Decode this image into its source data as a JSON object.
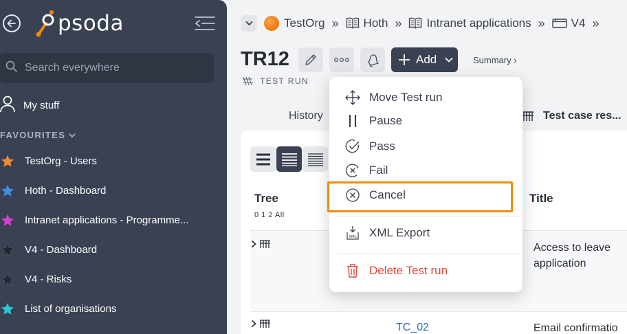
{
  "sidebar": {
    "logo_text": "psoda",
    "search_placeholder": "Search everywhere",
    "my_stuff_label": "My stuff",
    "favourites_header": "FAVOURITES",
    "favourites": [
      {
        "label": "TestOrg - Users",
        "star_color": "#f08a3a"
      },
      {
        "label": "Hoth - Dashboard",
        "star_color": "#3a8fe0"
      },
      {
        "label": "Intranet applications - Programme...",
        "star_color": "#d63fd0"
      },
      {
        "label": "V4 - Dashboard",
        "star_color": "#22262e"
      },
      {
        "label": "V4 - Risks",
        "star_color": "#22262e"
      },
      {
        "label": "List of organisations",
        "star_color": "#2ec3d6"
      }
    ]
  },
  "breadcrumb": {
    "items": [
      "TestOrg",
      "Hoth",
      "Intranet applications",
      "V4"
    ],
    "separator": "»"
  },
  "header": {
    "title": "TR12",
    "subtitle": "TEST RUN",
    "add_label": "Add",
    "summary_link": "Summary ›"
  },
  "tabs": {
    "history": "History",
    "test_case_results": "Test case res..."
  },
  "table": {
    "tree_header": "Tree",
    "tree_levels": "0 1 2 All",
    "title_header": "Title",
    "rows": [
      {
        "id": "",
        "title": "Access to leave application"
      },
      {
        "id": "TC_02",
        "title": "Email confirmatio"
      }
    ]
  },
  "menu": {
    "items": [
      {
        "label": "Move Test run",
        "icon": "move-icon"
      },
      {
        "label": "Pause",
        "icon": "pause-icon"
      },
      {
        "label": "Pass",
        "icon": "pass-icon"
      },
      {
        "label": "Fail",
        "icon": "fail-icon"
      },
      {
        "label": "Cancel",
        "icon": "cancel-icon"
      },
      {
        "label": "XML Export",
        "icon": "xml-export-icon"
      },
      {
        "label": "Delete Test run",
        "icon": "trash-icon"
      }
    ],
    "highlighted_item": "Cancel"
  },
  "colors": {
    "sidebar_bg": "#3a4152",
    "accent_orange": "#f28a0c",
    "danger": "#e0463b",
    "link_blue": "#2e6fb5"
  }
}
